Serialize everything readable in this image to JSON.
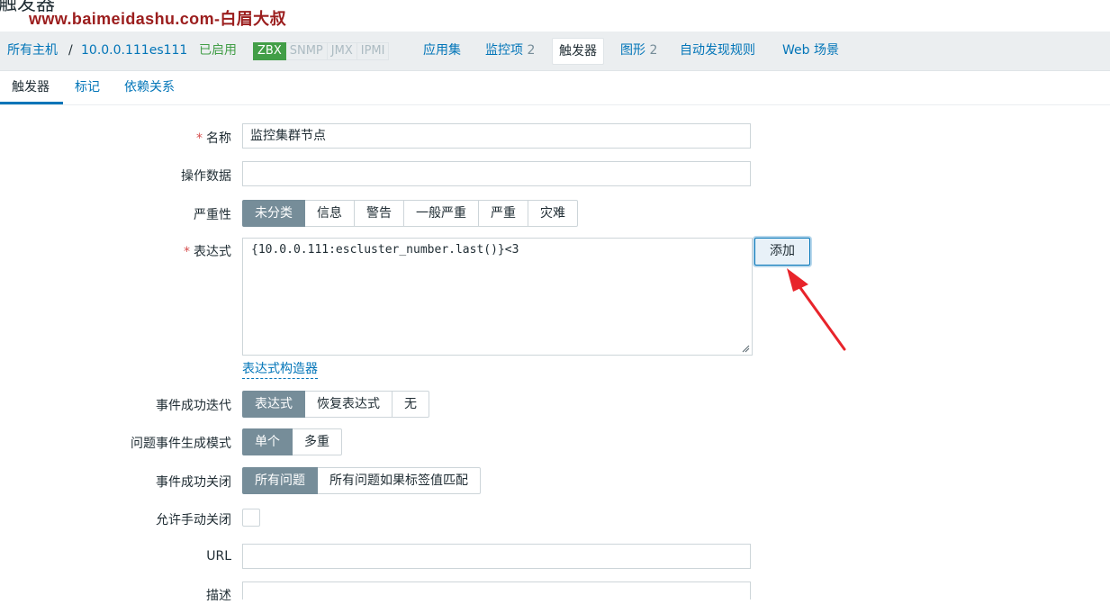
{
  "page": {
    "title": "触发器"
  },
  "watermark": "www.baimeidashu.com-白眉大叔",
  "breadcrumb": {
    "all_hosts": "所有主机",
    "separator": "/",
    "host": "10.0.0.111es111",
    "status": "已启用",
    "availability_tags": [
      "ZBX",
      "SNMP",
      "JMX",
      "IPMI"
    ],
    "applications": "应用集",
    "items": "监控项",
    "items_count": "2",
    "triggers": "触发器",
    "graphs": "图形",
    "graphs_count": "2",
    "discovery": "自动发现规则",
    "web": "Web 场景"
  },
  "tabs": [
    "触发器",
    "标记",
    "依赖关系"
  ],
  "form": {
    "name": {
      "label": "名称",
      "value": "监控集群节点"
    },
    "opdata": {
      "label": "操作数据",
      "value": ""
    },
    "severity": {
      "label": "严重性",
      "options": [
        "未分类",
        "信息",
        "警告",
        "一般严重",
        "严重",
        "灾难"
      ],
      "selected": "未分类"
    },
    "expression": {
      "label": "表达式",
      "value": "{10.0.0.111:escluster_number.last()}<3",
      "add_label": "添加",
      "builder_label": "表达式构造器"
    },
    "ok_event_generation": {
      "label": "事件成功迭代",
      "options": [
        "表达式",
        "恢复表达式",
        "无"
      ],
      "selected": "表达式"
    },
    "problem_event_mode": {
      "label": "问题事件生成模式",
      "options": [
        "单个",
        "多重"
      ],
      "selected": "单个"
    },
    "ok_event_closes": {
      "label": "事件成功关闭",
      "options": [
        "所有问题",
        "所有问题如果标签值匹配"
      ],
      "selected": "所有问题"
    },
    "manual_close": {
      "label": "允许手动关闭",
      "checked": false
    },
    "url": {
      "label": "URL",
      "value": ""
    },
    "description": {
      "label": "描述"
    }
  },
  "colors": {
    "accent": "#0275b8",
    "enabled": "#429e47",
    "selected": "#768d99",
    "required": "#d64e4e",
    "annotation_arrow": "#e8242b"
  }
}
